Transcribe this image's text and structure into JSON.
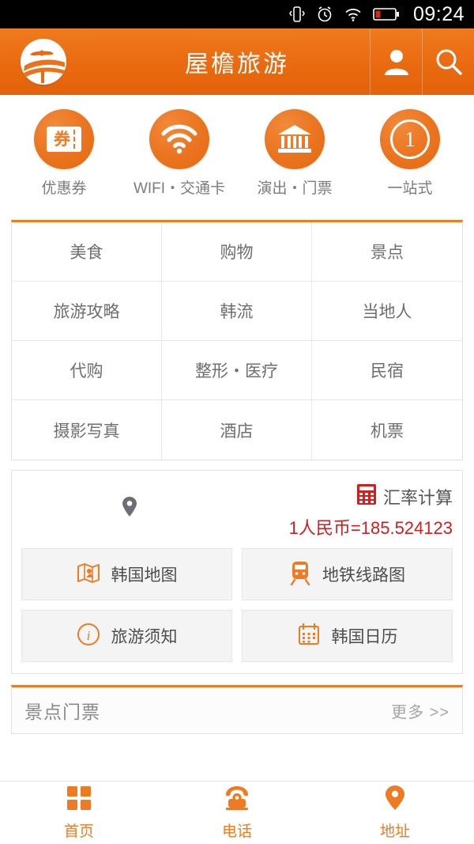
{
  "statusbar": {
    "time": "09:24",
    "icons": [
      "vibrate-icon",
      "alarm-icon",
      "wifi-icon",
      "battery-low-icon"
    ]
  },
  "header": {
    "title": "屋檐旅游",
    "logo_name": "app-logo",
    "actions": [
      {
        "name": "user-icon",
        "label": ""
      },
      {
        "name": "search-icon",
        "label": ""
      }
    ]
  },
  "quick_actions": [
    {
      "label": "优惠券",
      "icon": "coupon-icon"
    },
    {
      "label": "WIFI・交通卡",
      "icon": "wifi-card-icon"
    },
    {
      "label": "演出・门票",
      "icon": "theater-ticket-icon"
    },
    {
      "label": "一站式",
      "icon": "one-stop-icon",
      "badge": "1"
    }
  ],
  "categories": [
    "美食",
    "购物",
    "景点",
    "旅游攻略",
    "韩流",
    "当地人",
    "代购",
    "整形・医疗",
    "民宿",
    "摄影写真",
    "酒店",
    "机票"
  ],
  "tools": {
    "location_icon": "location-pin-icon",
    "rate": {
      "icon": "calculator-icon",
      "label": "汇率计算",
      "value": "1人民币=185.524123"
    },
    "buttons": [
      {
        "label": "韩国地图",
        "icon": "map-icon"
      },
      {
        "label": "地铁线路图",
        "icon": "subway-icon"
      },
      {
        "label": "旅游须知",
        "icon": "info-icon"
      },
      {
        "label": "韩国日历",
        "icon": "calendar-icon"
      }
    ]
  },
  "section": {
    "title": "景点门票",
    "more": "更多 >>"
  },
  "bottom_nav": [
    {
      "label": "首页",
      "icon": "grid-home-icon"
    },
    {
      "label": "电话",
      "icon": "telephone-icon"
    },
    {
      "label": "地址",
      "icon": "location-pin-icon"
    }
  ],
  "colors": {
    "brand_orange": "#ee7b22",
    "rate_red": "#cf1f1f",
    "statusbar_bg": "#000000",
    "battery_red": "#d32a1e"
  }
}
